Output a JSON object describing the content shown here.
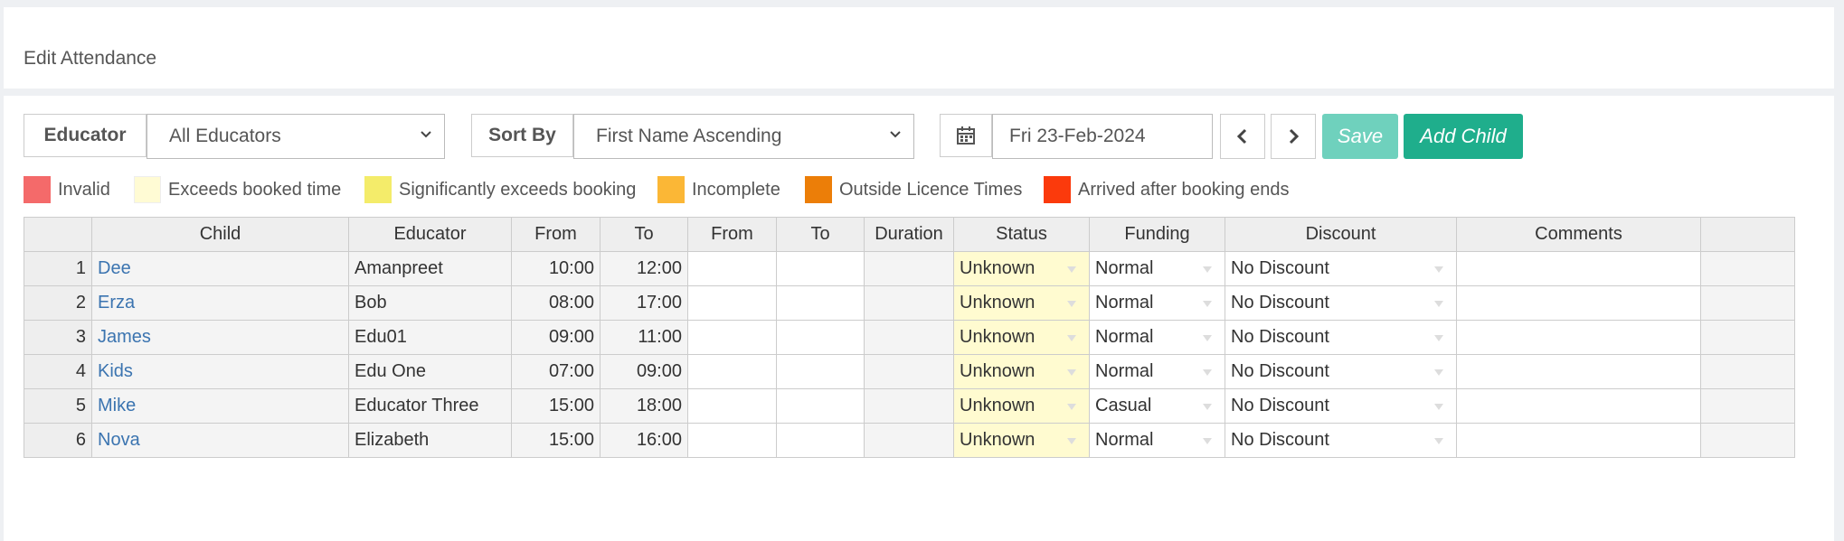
{
  "page": {
    "title": "Edit Attendance"
  },
  "toolbar": {
    "educator_label": "Educator",
    "educator_value": "All Educators",
    "sort_label": "Sort By",
    "sort_value": "First Name Ascending",
    "date_value": "Fri 23-Feb-2024",
    "save_label": "Save",
    "add_child_label": "Add Child",
    "colors": {
      "save": "#6fd1bd",
      "add_child": "#1fae8c"
    }
  },
  "legend": [
    {
      "label": "Invalid",
      "color": "#f46a6a"
    },
    {
      "label": "Exceeds booked time",
      "color": "#fffbd4"
    },
    {
      "label": "Significantly exceeds booking",
      "color": "#f4ec6a"
    },
    {
      "label": "Incomplete",
      "color": "#fbb736"
    },
    {
      "label": "Outside Licence Times",
      "color": "#ec7e08"
    },
    {
      "label": "Arrived after booking ends",
      "color": "#fb3a0c"
    }
  ],
  "table": {
    "headers": {
      "child": "Child",
      "educator": "Educator",
      "from": "From",
      "to": "To",
      "from2": "From",
      "to2": "To",
      "duration": "Duration",
      "status": "Status",
      "funding": "Funding",
      "discount": "Discount",
      "comments": "Comments"
    },
    "rows": [
      {
        "num": "1",
        "child": "Dee",
        "educator": "Amanpreet",
        "from": "10:00",
        "to": "12:00",
        "status": "Unknown",
        "funding": "Normal",
        "discount": "No Discount"
      },
      {
        "num": "2",
        "child": "Erza",
        "educator": "Bob",
        "from": "08:00",
        "to": "17:00",
        "status": "Unknown",
        "funding": "Normal",
        "discount": "No Discount"
      },
      {
        "num": "3",
        "child": "James",
        "educator": "Edu01",
        "from": "09:00",
        "to": "11:00",
        "status": "Unknown",
        "funding": "Normal",
        "discount": "No Discount"
      },
      {
        "num": "4",
        "child": "Kids",
        "educator": "Edu One",
        "from": "07:00",
        "to": "09:00",
        "status": "Unknown",
        "funding": "Normal",
        "discount": "No Discount"
      },
      {
        "num": "5",
        "child": "Mike",
        "educator": "Educator Three",
        "from": "15:00",
        "to": "18:00",
        "status": "Unknown",
        "funding": "Casual",
        "discount": "No Discount"
      },
      {
        "num": "6",
        "child": "Nova",
        "educator": "Elizabeth",
        "from": "15:00",
        "to": "16:00",
        "status": "Unknown",
        "funding": "Normal",
        "discount": "No Discount"
      }
    ]
  }
}
